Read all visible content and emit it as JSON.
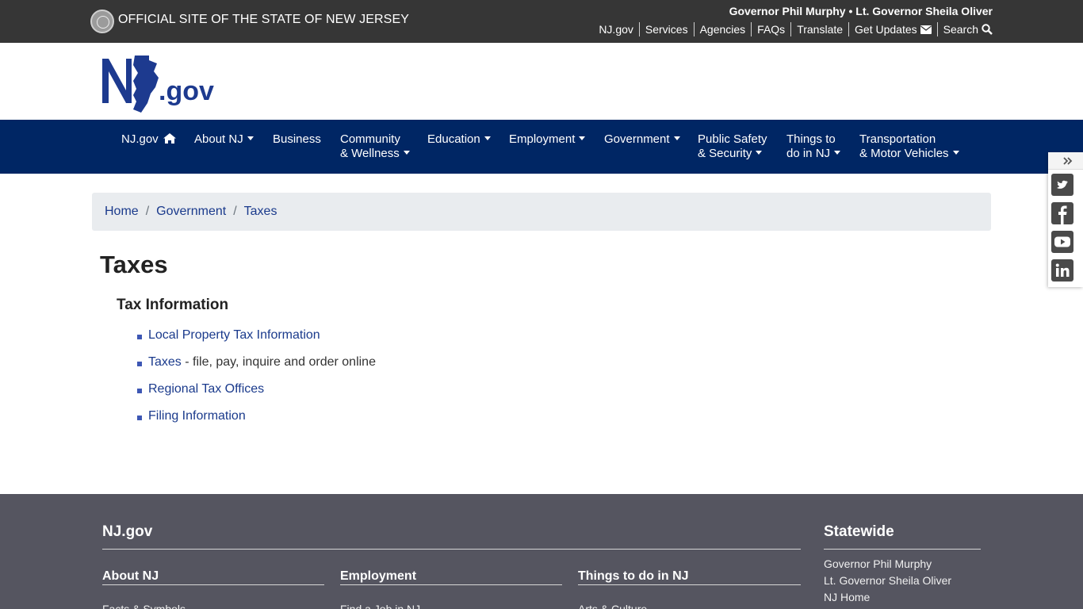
{
  "topbar": {
    "official_text": "OFFICIAL SITE OF THE STATE OF NEW JERSEY",
    "governor_line": "Governor Phil Murphy • Lt. Governor Sheila Oliver",
    "links": [
      "NJ.gov",
      "Services",
      "Agencies",
      "FAQs",
      "Translate",
      "Get Updates",
      "Search"
    ]
  },
  "logo": {
    "text": ".gov",
    "letters": "NJ"
  },
  "nav": {
    "items": [
      {
        "line1": "NJ.gov",
        "line2": ""
      },
      {
        "line1": "About NJ",
        "line2": ""
      },
      {
        "line1": "Business",
        "line2": ""
      },
      {
        "line1": "Community",
        "line2": "& Wellness"
      },
      {
        "line1": "Education",
        "line2": ""
      },
      {
        "line1": "Employment",
        "line2": ""
      },
      {
        "line1": "Government",
        "line2": ""
      },
      {
        "line1": "Public Safety",
        "line2": "& Security"
      },
      {
        "line1": "Things to",
        "line2": "do in NJ"
      },
      {
        "line1": "Transportation",
        "line2": "& Motor Vehicles"
      }
    ]
  },
  "breadcrumb": [
    "Home",
    "Government",
    "Taxes"
  ],
  "page": {
    "title": "Taxes",
    "section_title": "Tax Information",
    "items": [
      {
        "link": "Local Property Tax Information",
        "suffix": ""
      },
      {
        "link": "Taxes",
        "suffix": " - file, pay, inquire and order online"
      },
      {
        "link": "Regional Tax Offices",
        "suffix": ""
      },
      {
        "link": "Filing Information",
        "suffix": ""
      }
    ]
  },
  "social": {
    "icons": [
      "twitter-icon",
      "facebook-icon",
      "youtube-icon",
      "linkedin-icon"
    ]
  },
  "footer": {
    "main_heading": "NJ.gov",
    "columns": [
      {
        "title": "About NJ",
        "first_link": "Facts & Symbols"
      },
      {
        "title": "Employment",
        "first_link": "Find a Job in NJ"
      },
      {
        "title": "Things to do in NJ",
        "first_link": "Arts & Culture"
      }
    ],
    "statewide": {
      "title": "Statewide",
      "links": [
        "Governor Phil Murphy",
        "Lt. Governor Sheila Oliver",
        "NJ Home"
      ]
    }
  },
  "colors": {
    "topbar_bg": "#363636",
    "nav_bg": "#002664",
    "logo_blue": "#1d3a8f",
    "link_blue": "#1a3a8c",
    "footer_bg": "#555560"
  }
}
